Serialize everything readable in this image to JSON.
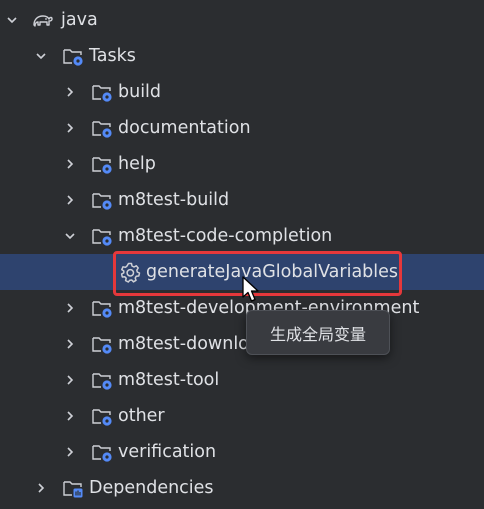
{
  "tree": {
    "root": {
      "label": "java"
    },
    "tasks": {
      "label": "Tasks"
    },
    "groups": [
      {
        "label": "build"
      },
      {
        "label": "documentation"
      },
      {
        "label": "help"
      },
      {
        "label": "m8test-build"
      },
      {
        "label": "m8test-code-completion"
      }
    ],
    "selected_task": {
      "label": "generateJavaGlobalVariables"
    },
    "more_groups": [
      {
        "label": "m8test-development-environment"
      },
      {
        "label": "m8test-download"
      },
      {
        "label": "m8test-tool"
      },
      {
        "label": "other"
      },
      {
        "label": "verification"
      }
    ],
    "dependencies": {
      "label": "Dependencies"
    }
  },
  "tooltip": {
    "text": "生成全局变量"
  },
  "colors": {
    "background": "#2b2d30",
    "selection": "#2e436e",
    "highlight_border": "#e5383b",
    "folder_outline": "#ced0d6",
    "gear_badge": "#548af7"
  }
}
